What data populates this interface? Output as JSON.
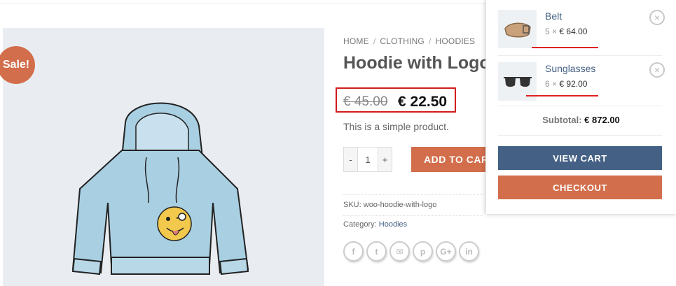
{
  "product": {
    "sale_badge": "Sale!",
    "breadcrumb": [
      "HOME",
      "CLOTHING",
      "HOODIES"
    ],
    "title": "Hoodie with Logo",
    "old_price": "€ 45.00",
    "new_price": "€ 22.50",
    "description": "This is a simple product.",
    "quantity": {
      "minus": "-",
      "value": "1",
      "plus": "+"
    },
    "add_to_cart_label": "ADD TO CART",
    "sku_label": "SKU:",
    "sku_value": "woo-hoodie-with-logo",
    "category_label": "Category:",
    "category_value": "Hoodies",
    "share_icons": [
      "facebook-icon",
      "twitter-icon",
      "email-icon",
      "pinterest-icon",
      "google-plus-icon",
      "linkedin-icon"
    ],
    "share_glyphs": [
      "f",
      "t",
      "✉",
      "p",
      "G+",
      "in"
    ]
  },
  "mini_cart": {
    "items": [
      {
        "name": "Belt",
        "quantity": "5",
        "times": "×",
        "price": "€ 64.00",
        "remove": "×"
      },
      {
        "name": "Sunglasses",
        "quantity": "6",
        "times": "×",
        "price": "€ 92.00",
        "remove": "×"
      }
    ],
    "subtotal_label": "Subtotal:",
    "subtotal_value": "€ 872.00",
    "view_cart_label": "VIEW CART",
    "checkout_label": "CHECKOUT"
  },
  "colors": {
    "accent": "#d26e4b",
    "primary": "#446084",
    "highlight": "#d11c1c"
  }
}
